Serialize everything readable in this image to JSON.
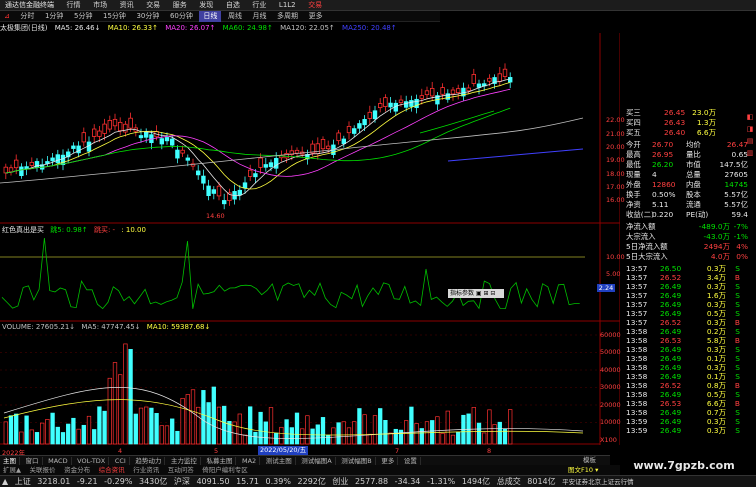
{
  "menu": {
    "app_title": "通达信金融终端",
    "items": [
      "行情",
      "市场",
      "资讯",
      "交易",
      "服务",
      "发现",
      "自选",
      "行业",
      "L1L2"
    ],
    "brand": "交易"
  },
  "periods": {
    "items": [
      "分时",
      "1分钟",
      "5分钟",
      "15分钟",
      "30分钟",
      "60分钟",
      "日线",
      "周线",
      "月线",
      "多周期",
      "更多"
    ],
    "active_index": 6,
    "func_label": "⊿"
  },
  "ma_header": {
    "title": "太极集团(日线)",
    "items": [
      {
        "label": "MA5: 26.46↓",
        "color": "#e8e8e8"
      },
      {
        "label": "MA10: 26.33↑",
        "color": "#ffff40"
      },
      {
        "label": "MA20: 26.07↑",
        "color": "#ff40ff"
      },
      {
        "label": "MA60: 24.98↑",
        "color": "#00e000"
      },
      {
        "label": "MA120: 22.05↑",
        "color": "#c0c0c0"
      },
      {
        "label": "MA250: 20.48↑",
        "color": "#4040ff"
      }
    ]
  },
  "price_axis": [
    "22.00",
    "21.00",
    "20.00",
    "19.00",
    "18.00",
    "17.00",
    "16.00"
  ],
  "low_annotation": "14.60",
  "indicator_header": {
    "title": "红色真出是买",
    "items": [
      {
        "label": "跳5: 0.98↑",
        "color": "#00e000"
      },
      {
        "label": "跳买: -",
        "color": "#ff4040"
      },
      {
        "label": ": 10.00",
        "color": "#ffff40"
      }
    ]
  },
  "indicator_axis": [
    "10.00",
    "5.00"
  ],
  "indicator_marker": "2.24",
  "indicator_tooltip": "指标参数 ▣ ⊞ ⊟",
  "volume_header": {
    "items": [
      {
        "label": "VOLUME: 27605.21↓",
        "color": "#e8e8e8"
      },
      {
        "label": "MA5: 47747.45↓",
        "color": "#e8e8e8"
      },
      {
        "label": "MA10: 59387.68↓",
        "color": "#ffff40"
      }
    ]
  },
  "volume_axis": [
    "60000",
    "50000",
    "40000",
    "30000",
    "20000",
    "10000",
    "X100"
  ],
  "x_axis": [
    {
      "label": "2022年",
      "highlight": false
    },
    {
      "label": "4",
      "highlight": false
    },
    {
      "label": "5",
      "highlight": false
    },
    {
      "label": "2022/05/20/五",
      "highlight": true
    },
    {
      "label": "7",
      "highlight": false
    },
    {
      "label": "8",
      "highlight": false
    }
  ],
  "quote": {
    "rows_top": [
      {
        "label": "买三",
        "value": "26.45",
        "vol": "23.0万"
      },
      {
        "label": "买四",
        "value": "26.43",
        "vol": "1.3万"
      },
      {
        "label": "买五",
        "value": "26.40",
        "vol": "6.6万"
      }
    ],
    "stats": [
      {
        "l1": "今开",
        "v1": "26.70",
        "l2": "均价",
        "v2": "26.47"
      },
      {
        "l1": "最高",
        "v1": "26.95",
        "l2": "量比",
        "v2": "0.65"
      },
      {
        "l1": "最低",
        "v1": "26.20",
        "l2": "市值",
        "v2": "147.5亿"
      },
      {
        "l1": "现量",
        "v1": "4",
        "l2": "总量",
        "v2": "27605"
      },
      {
        "l1": "外盘",
        "v1": "12860",
        "l2": "内盘",
        "v2": "14745"
      },
      {
        "l1": "换手",
        "v1": "0.50%",
        "l2": "股本",
        "v2": "5.57亿"
      },
      {
        "l1": "净资",
        "v1": "5.11",
        "l2": "流通",
        "v2": "5.57亿"
      },
      {
        "l1": "收益(二)",
        "v1": "0.220",
        "l2": "PE(动)",
        "v2": "59.4"
      }
    ],
    "flows": [
      {
        "label": "净流入额",
        "value": "-489.0万",
        "pct": "-7%"
      },
      {
        "label": "大宗流入",
        "value": "-43.0万",
        "pct": "-1%"
      },
      {
        "label": "5日净流入额",
        "value": "2494万",
        "pct": "4%"
      },
      {
        "label": "5日大宗流入",
        "value": "4.0万",
        "pct": "0%"
      }
    ],
    "ticks": [
      {
        "t": "13:57",
        "p": "26.50",
        "v": "0.3万",
        "d": "S"
      },
      {
        "t": "13:57",
        "p": "26.52",
        "v": "3.4万",
        "d": "B"
      },
      {
        "t": "13:57",
        "p": "26.49",
        "v": "0.3万",
        "d": "S"
      },
      {
        "t": "13:57",
        "p": "26.49",
        "v": "1.6万",
        "d": "S"
      },
      {
        "t": "13:57",
        "p": "26.49",
        "v": "0.3万",
        "d": "S"
      },
      {
        "t": "13:57",
        "p": "26.49",
        "v": "0.5万",
        "d": "S"
      },
      {
        "t": "13:57",
        "p": "26.52",
        "v": "0.3万",
        "d": "B"
      },
      {
        "t": "13:58",
        "p": "26.49",
        "v": "0.2万",
        "d": "S"
      },
      {
        "t": "13:58",
        "p": "26.53",
        "v": "5.8万",
        "d": "B"
      },
      {
        "t": "13:58",
        "p": "26.49",
        "v": "0.3万",
        "d": "S"
      },
      {
        "t": "13:58",
        "p": "26.49",
        "v": "0.1万",
        "d": "S"
      },
      {
        "t": "13:58",
        "p": "26.49",
        "v": "0.3万",
        "d": "S"
      },
      {
        "t": "13:58",
        "p": "26.49",
        "v": "0.1万",
        "d": "S"
      },
      {
        "t": "13:58",
        "p": "26.52",
        "v": "0.8万",
        "d": "B"
      },
      {
        "t": "13:58",
        "p": "26.49",
        "v": "0.5万",
        "d": "S"
      },
      {
        "t": "13:58",
        "p": "26.53",
        "v": "6.6万",
        "d": "B"
      },
      {
        "t": "13:58",
        "p": "26.49",
        "v": "0.7万",
        "d": "S"
      },
      {
        "t": "13:59",
        "p": "26.49",
        "v": "0.3万",
        "d": "S"
      },
      {
        "t": "13:59",
        "p": "26.49",
        "v": "0.3万",
        "d": "S"
      }
    ]
  },
  "tabs": [
    "主图",
    "窗口",
    "MACD",
    "VOL-TDX",
    "CCI",
    "趋势动力",
    "主力监控",
    "私募主图",
    "MA2",
    "测试主图",
    "测试幅图A",
    "测试幅图B",
    "更多",
    "设置"
  ],
  "tabs_right": [
    "模板",
    "▲"
  ],
  "infobar": [
    "扩展▲",
    "关联报价",
    "资金分布",
    "综合资讯",
    "行业资讯",
    "互动问答",
    "倚阳户编利专区"
  ],
  "infobar_right": "图文F10 ▾",
  "watermark": "www.7gpzb.com",
  "status": [
    {
      "label": "上证",
      "value": "3218.01",
      "chg": "-9.21",
      "pct": "-0.29%",
      "amt": "3430亿",
      "dir": "down"
    },
    {
      "label": "沪深",
      "value": "4091.50",
      "chg": "15.71",
      "pct": "0.39%",
      "amt": "2292亿",
      "dir": "up"
    },
    {
      "label": "创业",
      "value": "2577.88",
      "chg": "-34.34",
      "pct": "-1.31%",
      "amt": "1494亿",
      "dir": "down"
    }
  ],
  "status_tail": [
    "总成交",
    "8014亿",
    "平安证券北京上证云行情"
  ]
}
